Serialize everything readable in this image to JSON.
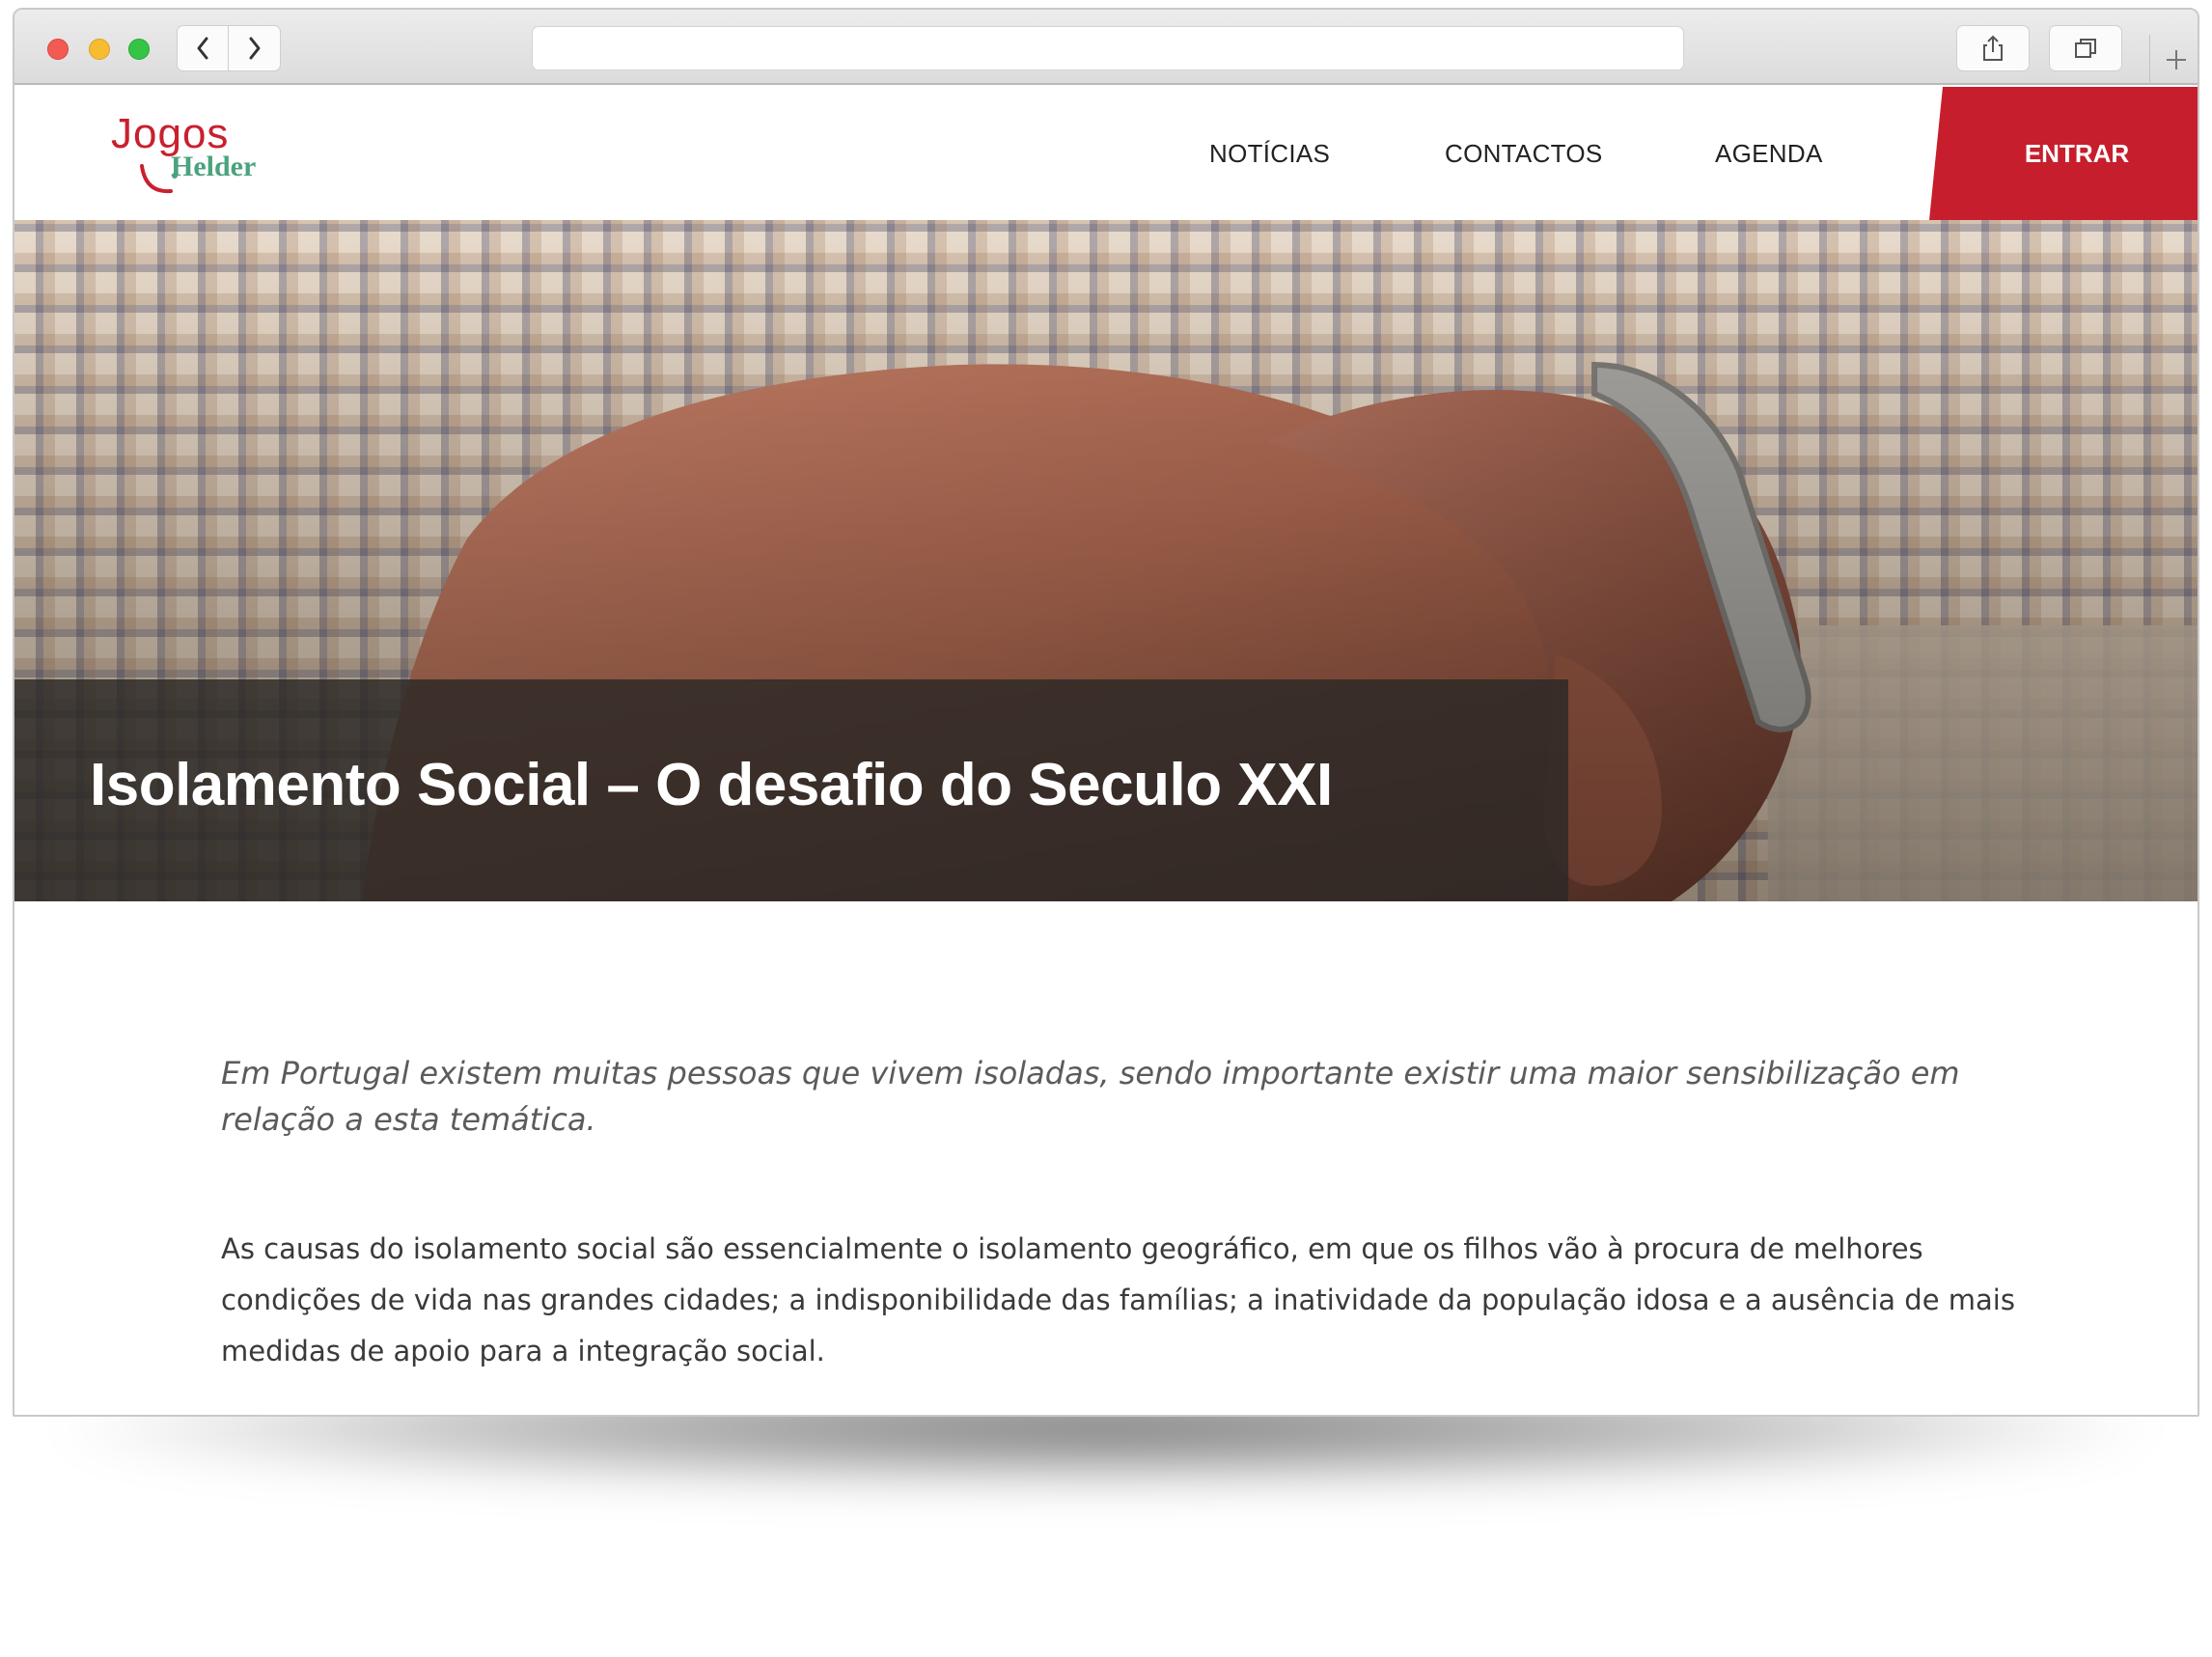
{
  "browser": {
    "url": "",
    "icons": [
      "back-icon",
      "forward-icon",
      "share-icon",
      "tabs-icon",
      "plus-icon"
    ]
  },
  "site": {
    "logo": {
      "word1": "Jogos",
      "word2": "Helder"
    },
    "nav": {
      "noticias": "NOTÍCIAS",
      "contactos": "CONTACTOS",
      "agenda": "AGENDA"
    },
    "cta": "ENTRAR",
    "accent_color": "#c71e2d"
  },
  "hero": {
    "title": "Isolamento Social – O desafio do Seculo XXI"
  },
  "article": {
    "lead": "Em Portugal existem muitas pessoas que vivem isoladas, sendo importante existir uma maior sensibilização em relação a esta temática.",
    "body": "As causas do isolamento social são essencialmente o isolamento geográfico, em que os filhos vão à procura de melhores condições de vida nas grandes cidades; a indisponibilidade das famílias; a inatividade da população idosa e a ausência de mais medidas de apoio para a integração social."
  }
}
